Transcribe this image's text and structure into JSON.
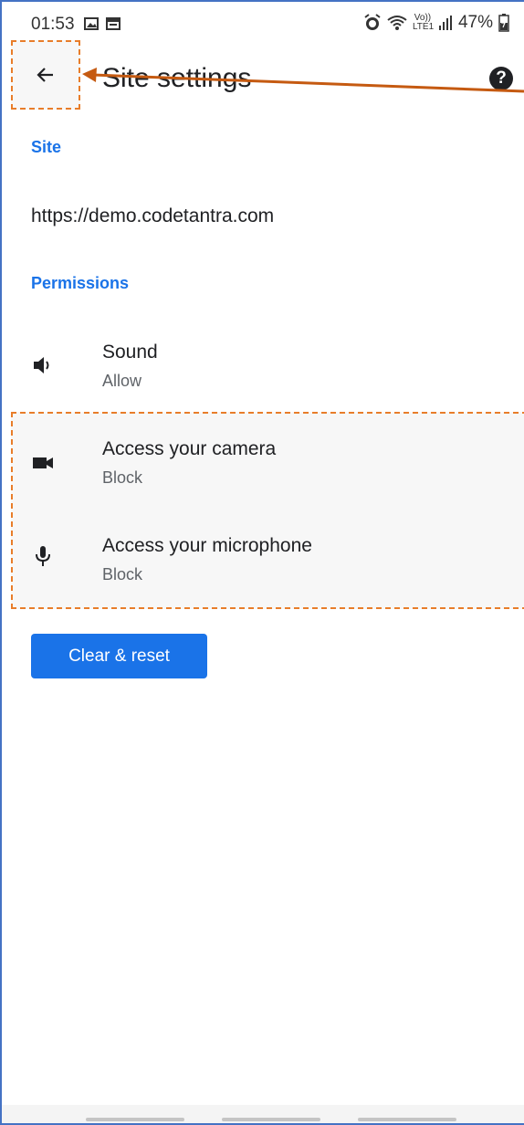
{
  "status_bar": {
    "time": "01:53",
    "battery": "47%",
    "network": "Vo)) LTE1"
  },
  "app_bar": {
    "title": "Site settings",
    "help_label": "?"
  },
  "site_section": {
    "header": "Site",
    "url": "https://demo.codetantra.com"
  },
  "permissions_section": {
    "header": "Permissions",
    "items": [
      {
        "title": "Sound",
        "value": "Allow",
        "icon": "speaker-icon"
      },
      {
        "title": "Access your camera",
        "value": "Block",
        "icon": "camera-icon"
      },
      {
        "title": "Access your microphone",
        "value": "Block",
        "icon": "microphone-icon"
      }
    ]
  },
  "actions": {
    "clear_label": "Clear & reset"
  },
  "colors": {
    "accent": "#1a73e8",
    "annotation": "#e87d2a",
    "arrow": "#c55a11"
  }
}
